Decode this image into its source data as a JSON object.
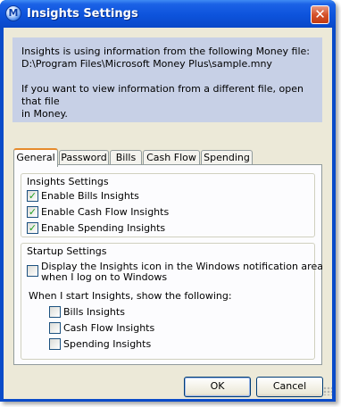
{
  "window": {
    "title": "Insights Settings",
    "app_icon_letter": "M"
  },
  "info": {
    "line1": "Insights is using information from the following Money file:",
    "line2": "D:\\Program Files\\Microsoft Money Plus\\sample.mny",
    "line3": "If you want to view information from a different file, open that file",
    "line4": "in Money."
  },
  "tabs": [
    "General",
    "Password",
    "Bills",
    "Cash Flow",
    "Spending"
  ],
  "insights_group": {
    "title": "Insights Settings",
    "items": [
      {
        "label": "Enable Bills Insights",
        "checked": true
      },
      {
        "label": "Enable Cash Flow Insights",
        "checked": true
      },
      {
        "label": "Enable Spending Insights",
        "checked": true
      }
    ]
  },
  "startup_group": {
    "title": "Startup Settings",
    "notify_line1": "Display the Insights icon in the Windows notification area",
    "notify_line2": "when I log on to Windows",
    "notify_checked": false,
    "show_label": "When I start Insights, show the following:",
    "show_items": [
      {
        "label": "Bills Insights",
        "checked": false
      },
      {
        "label": "Cash Flow Insights",
        "checked": false
      },
      {
        "label": "Spending Insights",
        "checked": false
      }
    ]
  },
  "buttons": {
    "ok": "OK",
    "cancel": "Cancel"
  },
  "close_glyph": "✕"
}
